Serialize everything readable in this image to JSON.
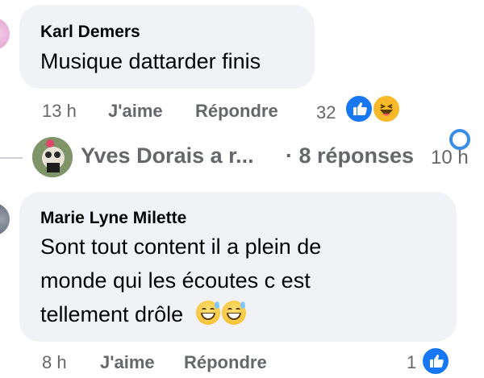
{
  "comments": [
    {
      "author": "Karl Demers",
      "text": "Musique dattarder finis",
      "time": "13 h",
      "like_label": "J'aime",
      "reply_label": "Répondre",
      "reaction_count": "32",
      "reaction_icons": [
        "like-icon",
        "haha-icon"
      ]
    },
    {
      "author": "Marie Lyne Milette",
      "text_line1": "Sont tout content il a plein de",
      "text_line2": "monde qui les écoutes c est",
      "text_line3": "tellement drôle",
      "emojis": [
        "grinning-sweat-emoji",
        "grinning-sweat-emoji"
      ],
      "time": "8 h",
      "like_label": "J'aime",
      "reply_label": "Répondre",
      "reaction_count": "1",
      "reaction_icons": [
        "like-icon"
      ]
    }
  ],
  "replies_thread": {
    "text": "Yves Dorais a r...",
    "count_text": "· 8 réponses",
    "time": "10 h"
  },
  "colors": {
    "bubble": "#f0f2f5",
    "meta_text": "#65676b",
    "like_blue": "#1877f2",
    "haha_yellow": "#f7b928"
  }
}
